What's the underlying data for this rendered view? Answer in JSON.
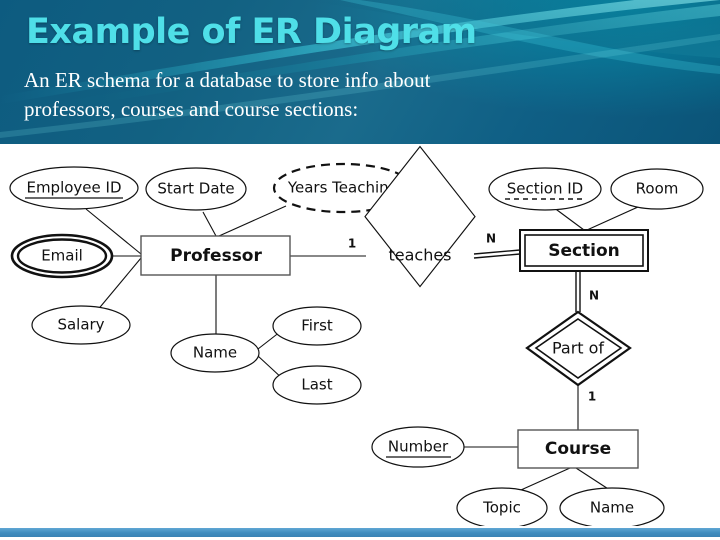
{
  "slide": {
    "title": "Example of ER Diagram",
    "body_line1": "An ER schema for a database to store info about",
    "body_line2": "professors, courses and course sections:",
    "title_color": "#4fdfe8",
    "header_color": "#126182",
    "footer_bar_color": "#3f8cbe",
    "diagram_background": "#ffffff",
    "diagram_line_color": "#111111"
  },
  "diagram": {
    "type": "entity-relationship-diagram",
    "notation": "Chen",
    "entities": [
      {
        "id": "professor",
        "label": "Professor",
        "kind": "strong-entity",
        "attributes": [
          "employee_id",
          "email",
          "salary",
          "start_date",
          "years_teaching",
          "prof_name"
        ]
      },
      {
        "id": "section",
        "label": "Section",
        "kind": "weak-entity",
        "attributes": [
          "section_id",
          "room"
        ]
      },
      {
        "id": "course",
        "label": "Course",
        "kind": "strong-entity",
        "attributes": [
          "number",
          "topic",
          "course_name"
        ]
      }
    ],
    "relationships": [
      {
        "id": "teaches",
        "label": "teaches",
        "kind": "relationship",
        "from": "professor",
        "to": "section",
        "from_cardinality": "1",
        "to_cardinality": "N",
        "identifying": false
      },
      {
        "id": "part_of",
        "label": "Part of",
        "kind": "identifying-relationship",
        "from": "section",
        "to": "course",
        "from_cardinality": "N",
        "to_cardinality": "1",
        "identifying": true
      }
    ],
    "attributes": [
      {
        "id": "employee_id",
        "label": "Employee ID",
        "kind": "key",
        "owner": "professor"
      },
      {
        "id": "email",
        "label": "Email",
        "kind": "multivalued",
        "owner": "professor"
      },
      {
        "id": "salary",
        "label": "Salary",
        "kind": "simple",
        "owner": "professor"
      },
      {
        "id": "start_date",
        "label": "Start Date",
        "kind": "simple",
        "owner": "professor"
      },
      {
        "id": "years_teaching",
        "label": "Years Teaching",
        "kind": "derived",
        "owner": "professor"
      },
      {
        "id": "prof_name",
        "label": "Name",
        "kind": "composite",
        "owner": "professor",
        "children": [
          "first",
          "last"
        ]
      },
      {
        "id": "first",
        "label": "First",
        "kind": "simple",
        "owner": "prof_name"
      },
      {
        "id": "last",
        "label": "Last",
        "kind": "simple",
        "owner": "prof_name"
      },
      {
        "id": "section_id",
        "label": "Section ID",
        "kind": "partial-key",
        "owner": "section"
      },
      {
        "id": "room",
        "label": "Room",
        "kind": "simple",
        "owner": "section"
      },
      {
        "id": "number",
        "label": "Number",
        "kind": "key",
        "owner": "course"
      },
      {
        "id": "topic",
        "label": "Topic",
        "kind": "simple",
        "owner": "course"
      },
      {
        "id": "course_name",
        "label": "Name",
        "kind": "simple",
        "owner": "course"
      }
    ],
    "cardinality_labels": [
      "1",
      "N",
      "N",
      "1"
    ]
  }
}
